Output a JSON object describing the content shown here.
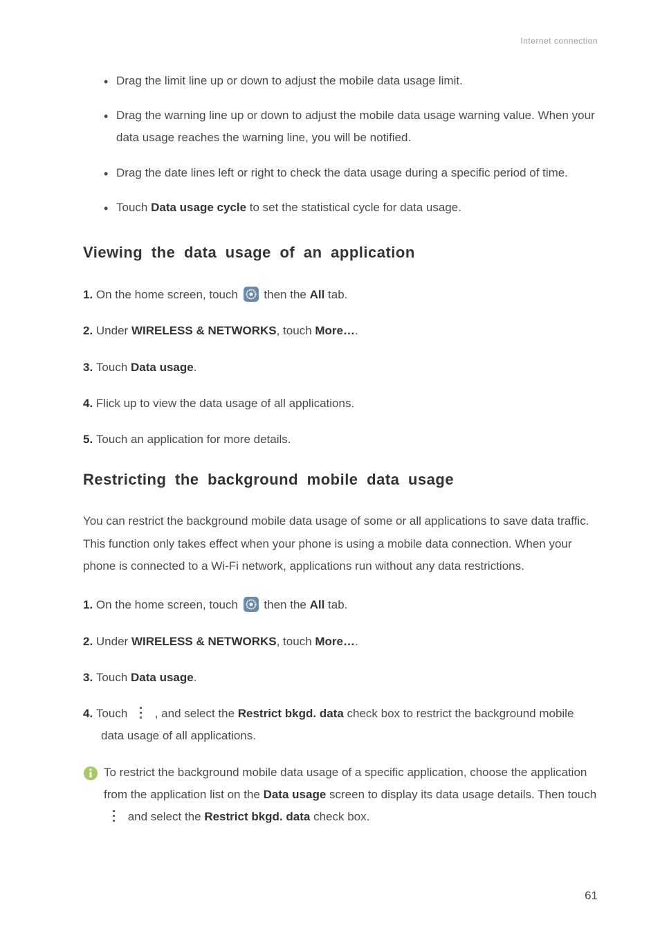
{
  "header": {
    "category": "Internet connection"
  },
  "bullets": {
    "b1": "Drag the limit line up or down to adjust the mobile data usage limit.",
    "b2": "Drag the warning line up or down to adjust the mobile data usage warning value. When your data usage reaches the warning line, you will be notified.",
    "b3": "Drag the date lines left or right to check the data usage during a specific period of time.",
    "b4_pre": "Touch ",
    "b4_bold": "Data usage cycle",
    "b4_post": " to set the statistical cycle for data usage."
  },
  "section_viewing": {
    "title": "Viewing the data usage of an application",
    "s1_pre": "On the home screen, touch ",
    "s1_mid": " then the ",
    "s1_bold": "All",
    "s1_post": " tab.",
    "s2_pre": "Under ",
    "s2_bold1": "WIRELESS & NETWORKS",
    "s2_mid": ", touch ",
    "s2_bold2": "More…",
    "s2_post": ".",
    "s3_pre": "Touch ",
    "s3_bold": "Data usage",
    "s3_post": ".",
    "s4": "Flick up to view the data usage of all applications.",
    "s5": "Touch an application for more details."
  },
  "section_restrict": {
    "title": "Restricting the background mobile data usage",
    "intro": "You can restrict the background mobile data usage of some or all applications to save data traffic. This function only takes effect when your phone is using a mobile data connection. When your phone is connected to a Wi-Fi network, applications run without any data restrictions.",
    "s1_pre": "On the home screen, touch ",
    "s1_mid": " then the ",
    "s1_bold": "All",
    "s1_post": " tab.",
    "s2_pre": "Under ",
    "s2_bold1": "WIRELESS & NETWORKS",
    "s2_mid": ", touch ",
    "s2_bold2": "More…",
    "s2_post": ".",
    "s3_pre": "Touch ",
    "s3_bold": "Data usage",
    "s3_post": ".",
    "s4_pre": "Touch ",
    "s4_mid": " , and select the ",
    "s4_bold": "Restrict bkgd. data",
    "s4_post": " check box to restrict the background mobile data usage of all applications."
  },
  "note": {
    "p1_a": "To restrict the background mobile data usage of a specific application, choose the application from the application list on the ",
    "p1_bold": "Data usage",
    "p1_b": " screen to display its data usage details. Then touch ",
    "p1_c": " and select the ",
    "p1_bold2": "Restrict bkgd. data",
    "p1_d": " check box."
  },
  "steps": {
    "n1": "1. ",
    "n2": "2. ",
    "n3": "3. ",
    "n4": "4. ",
    "n5": "5. "
  },
  "page_number": "61",
  "icons": {
    "settings": "settings-icon",
    "menu": "menu-icon",
    "info": "info-icon"
  }
}
